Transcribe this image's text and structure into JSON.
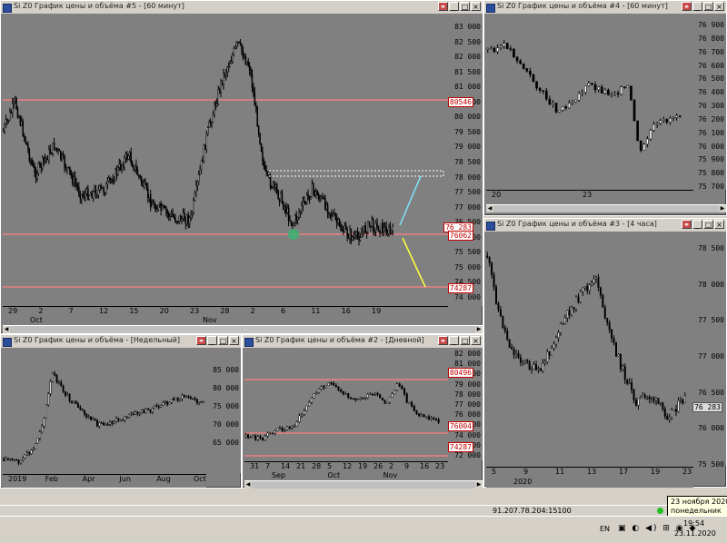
{
  "windows": [
    {
      "id": "w5",
      "title": "Si Z0 График цены и объёма #5 - [60 минут]",
      "yticks": [
        "83 000",
        "82 500",
        "82 000",
        "81 500",
        "81 000",
        "80 500",
        "80 000",
        "79 500",
        "79 000",
        "78 500",
        "78 000",
        "77 500",
        "77 000",
        "76 500",
        "76 000",
        "75 500",
        "75 000",
        "74 500",
        "74 000"
      ],
      "levels": [
        "80546",
        "76062",
        "74287"
      ],
      "last_price": "76 283",
      "xticks": [
        "29",
        "2",
        "7",
        "12",
        "15",
        "20",
        "23",
        "28",
        "2",
        "6",
        "11",
        "16",
        "19"
      ],
      "months": [
        "Oct",
        "Nov"
      ]
    },
    {
      "id": "w4",
      "title": "Si Z0 График цены и объёма #4 - [60 минут]",
      "yticks": [
        "76 900",
        "76 800",
        "76 700",
        "76 600",
        "76 500",
        "76 400",
        "76 300",
        "76 200",
        "76 100",
        "76 000",
        "75 900",
        "75 800",
        "75 700"
      ],
      "xticks": [
        "20",
        "23"
      ],
      "months": []
    },
    {
      "id": "w3",
      "title": "Si Z0 График цены и объёма #3 - [4 часа]",
      "yticks": [
        "78 500",
        "78 000",
        "77 500",
        "77 000",
        "76 500",
        "76 000",
        "75 500"
      ],
      "last_price": "76 283",
      "xticks": [
        "5",
        "9",
        "11",
        "13",
        "17",
        "19",
        "23"
      ],
      "months": [
        "2020"
      ]
    },
    {
      "id": "w1",
      "title": "Si Z0 График цены и объёма - [Недельный]",
      "yticks": [
        "85 000",
        "80 000",
        "75 000",
        "70 000",
        "65 000"
      ],
      "xticks": [
        "2019",
        "Feb",
        "Apr",
        "Jun",
        "Aug",
        "Oct"
      ],
      "months": []
    },
    {
      "id": "w2",
      "title": "Si Z0 График цены и объёма #2 - [Дневной]",
      "yticks": [
        "82 000",
        "81 000",
        "80 000",
        "79 000",
        "78 000",
        "77 000",
        "76 000",
        "75 000",
        "74 000",
        "73 000",
        "72 000"
      ],
      "levels": [
        "80496",
        "76004",
        "74287"
      ],
      "xticks": [
        "31",
        "7",
        "14",
        "21",
        "28",
        "5",
        "12",
        "19",
        "26",
        "2",
        "9",
        "16",
        "23"
      ],
      "months": [
        "Sep",
        "Oct",
        "Nov"
      ]
    }
  ],
  "status": {
    "server": "91.207.78.204:15100"
  },
  "tooltip": {
    "line1": "23 ноября 2020 г.",
    "line2": "понедельник"
  },
  "taskbar": {
    "lang": "EN",
    "time": "19:54",
    "date": "23.11.2020"
  },
  "colors": {
    "level_line": "#ff8080",
    "cyan_trend": "#7fe5ff",
    "yellow_trend": "#ffff40",
    "marker": "#3cb371"
  }
}
